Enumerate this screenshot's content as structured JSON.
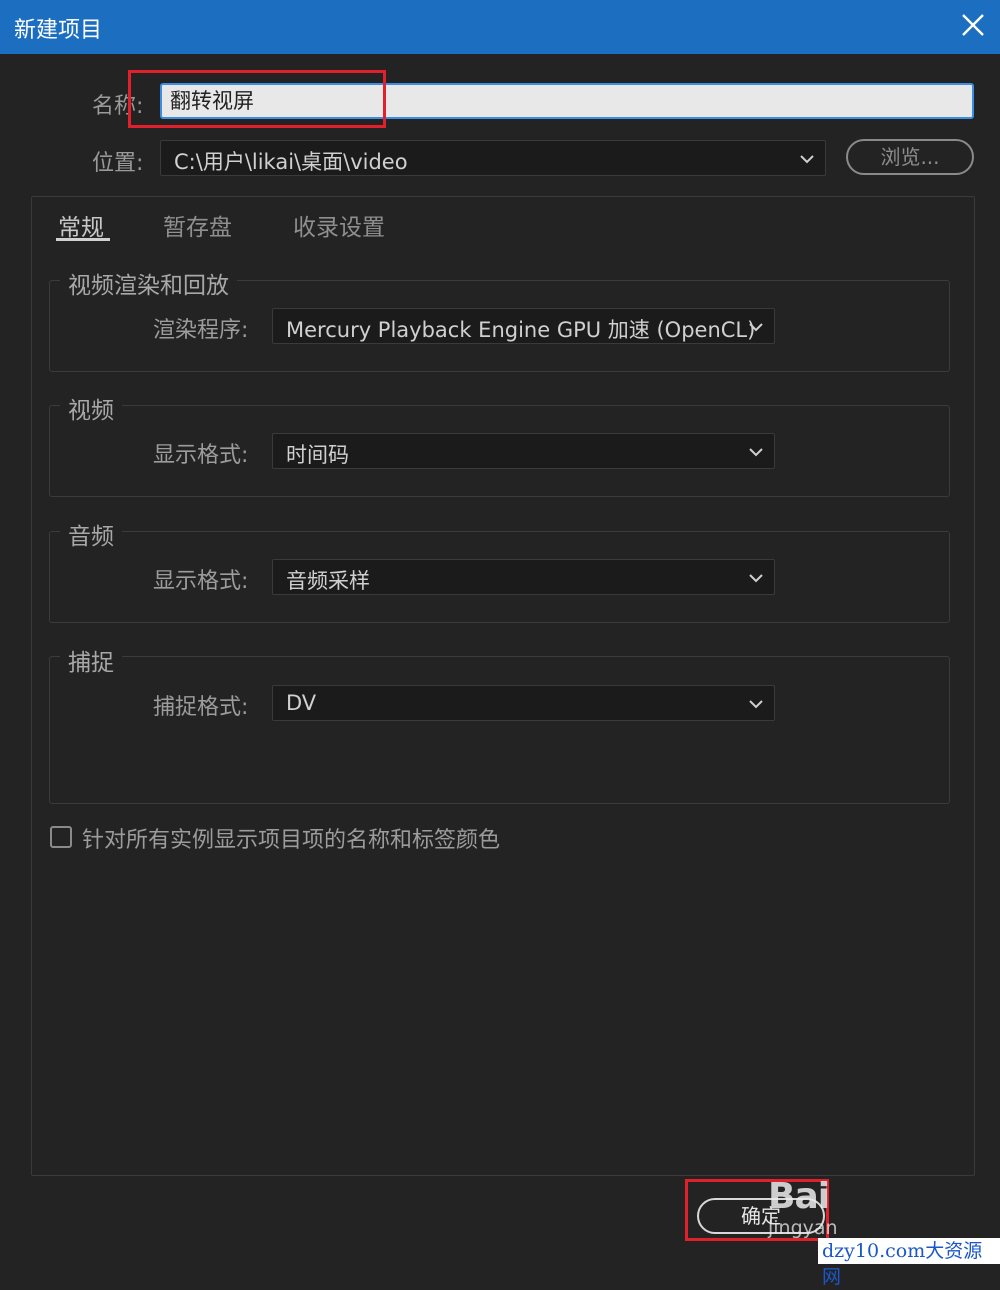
{
  "window": {
    "title": "新建项目"
  },
  "form": {
    "name_label": "名称:",
    "name_value": "翻转视屏",
    "location_label": "位置:",
    "location_value": "C:\\用户\\likai\\桌面\\video",
    "browse_label": "浏览..."
  },
  "tabs": [
    {
      "label": "常规",
      "active": true
    },
    {
      "label": "暂存盘",
      "active": false
    },
    {
      "label": "收录设置",
      "active": false
    }
  ],
  "groups": {
    "render": {
      "title": "视频渲染和回放",
      "field_label": "渲染程序:",
      "value": "Mercury Playback Engine GPU 加速 (OpenCL)"
    },
    "video": {
      "title": "视频",
      "field_label": "显示格式:",
      "value": "时间码"
    },
    "audio": {
      "title": "音频",
      "field_label": "显示格式:",
      "value": "音频采样"
    },
    "capture": {
      "title": "捕捉",
      "field_label": "捕捉格式:",
      "value": "DV"
    }
  },
  "checkbox": {
    "label": "针对所有实例显示项目项的名称和标签颜色",
    "checked": false
  },
  "footer": {
    "ok_label": "确定"
  },
  "watermark": {
    "baidu": "Bai",
    "jingyan": "jingyan",
    "site": "dzy10.com大资源网"
  },
  "colors": {
    "titlebar": "#1c6fc0",
    "background": "#232323",
    "highlight_box": "#e0202a",
    "focus_border": "#3a8ee6"
  }
}
